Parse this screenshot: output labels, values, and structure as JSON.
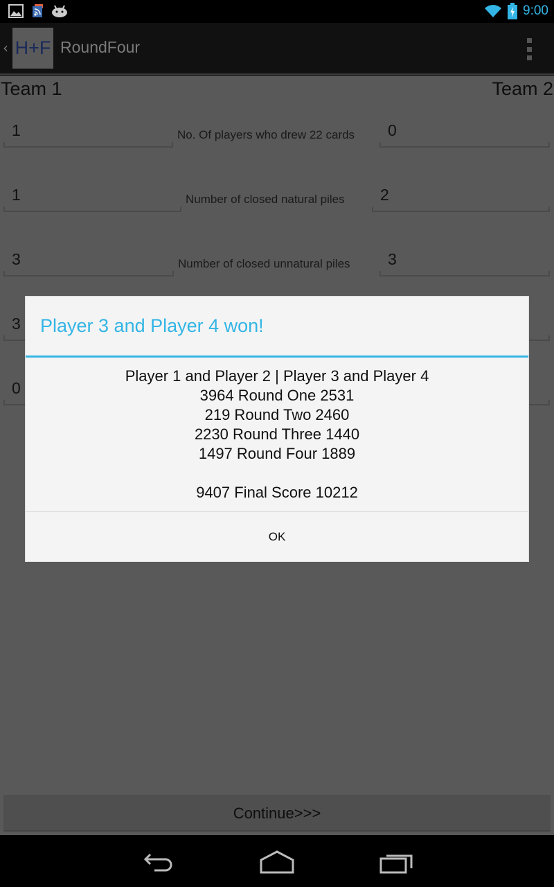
{
  "status_bar": {
    "left_icons": [
      "gallery-icon",
      "rss-icon",
      "android-icon"
    ],
    "right_icons": [
      "wifi-icon",
      "battery-charging-icon"
    ],
    "time": "9:00",
    "accent_color": "#33b5e5"
  },
  "action_bar": {
    "logo_text": "H+F",
    "title": "RoundFour",
    "overflow_icon": "overflow-menu-icon"
  },
  "content": {
    "team1_label": "Team 1",
    "team2_label": "Team 2",
    "rows": [
      {
        "label": "No. Of players who drew 22 cards",
        "team1_value": "1",
        "team2_value": "0"
      },
      {
        "label": "Number of closed natural piles",
        "team1_value": "1",
        "team2_value": "2"
      },
      {
        "label": "Number of closed unnatural piles",
        "team1_value": "3",
        "team2_value": "3"
      },
      {
        "label": "",
        "team1_value": "3",
        "team2_value": ""
      },
      {
        "label": "",
        "team1_value": "0",
        "team2_value": ""
      }
    ],
    "continue_label": "Continue>>>"
  },
  "dialog": {
    "title": "Player 3 and Player 4 won!",
    "title_color": "#33b5e5",
    "header_line": "Player 1 and Player 2 | Player 3 and Player 4",
    "rounds": [
      {
        "team1": "3964",
        "label": "Round One",
        "team2": "2531",
        "text": "3964  Round One  2531"
      },
      {
        "team1": "219",
        "label": "Round Two",
        "team2": "2460",
        "text": "219  Round Two  2460"
      },
      {
        "team1": "2230",
        "label": "Round Three",
        "team2": "1440",
        "text": "2230  Round Three  1440"
      },
      {
        "team1": "1497",
        "label": "Round Four",
        "team2": "1889",
        "text": "1497  Round Four  1889"
      }
    ],
    "final": {
      "team1": "9407",
      "label": "Final Score",
      "team2": "10212",
      "text": "9407  Final Score  10212"
    },
    "ok_label": "OK"
  },
  "nav_bar": {
    "buttons": [
      "back-icon",
      "home-icon",
      "recent-apps-icon"
    ]
  }
}
